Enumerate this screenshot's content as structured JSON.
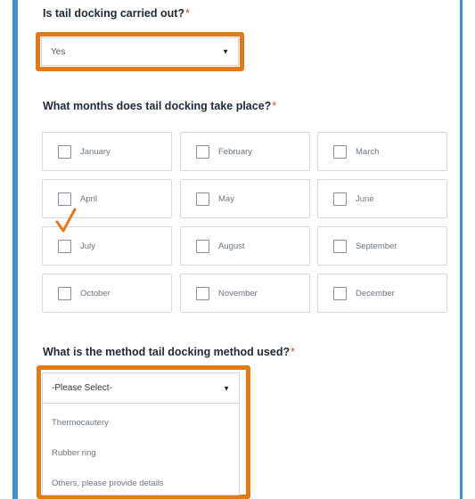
{
  "q1": {
    "text": "Is tail docking carried out?",
    "req": "*",
    "value": "Yes"
  },
  "q2": {
    "text": "What months does tail docking take place?",
    "req": "*",
    "months": [
      "January",
      "February",
      "March",
      "April",
      "May",
      "June",
      "July",
      "August",
      "September",
      "October",
      "November",
      "December"
    ]
  },
  "q3": {
    "text": "What is the method tail docking method used?",
    "req": "*",
    "selected": "-Please Select-",
    "options": [
      "Thermocautery",
      "Rubber ring",
      "Others, please provide details"
    ]
  },
  "colors": {
    "highlight": "#e07a1a",
    "accent": "#3e8fd6",
    "required": "#d94a3a"
  },
  "icons": {
    "dropdown": "chevron-down-icon",
    "annotation": "checkmark-icon"
  }
}
